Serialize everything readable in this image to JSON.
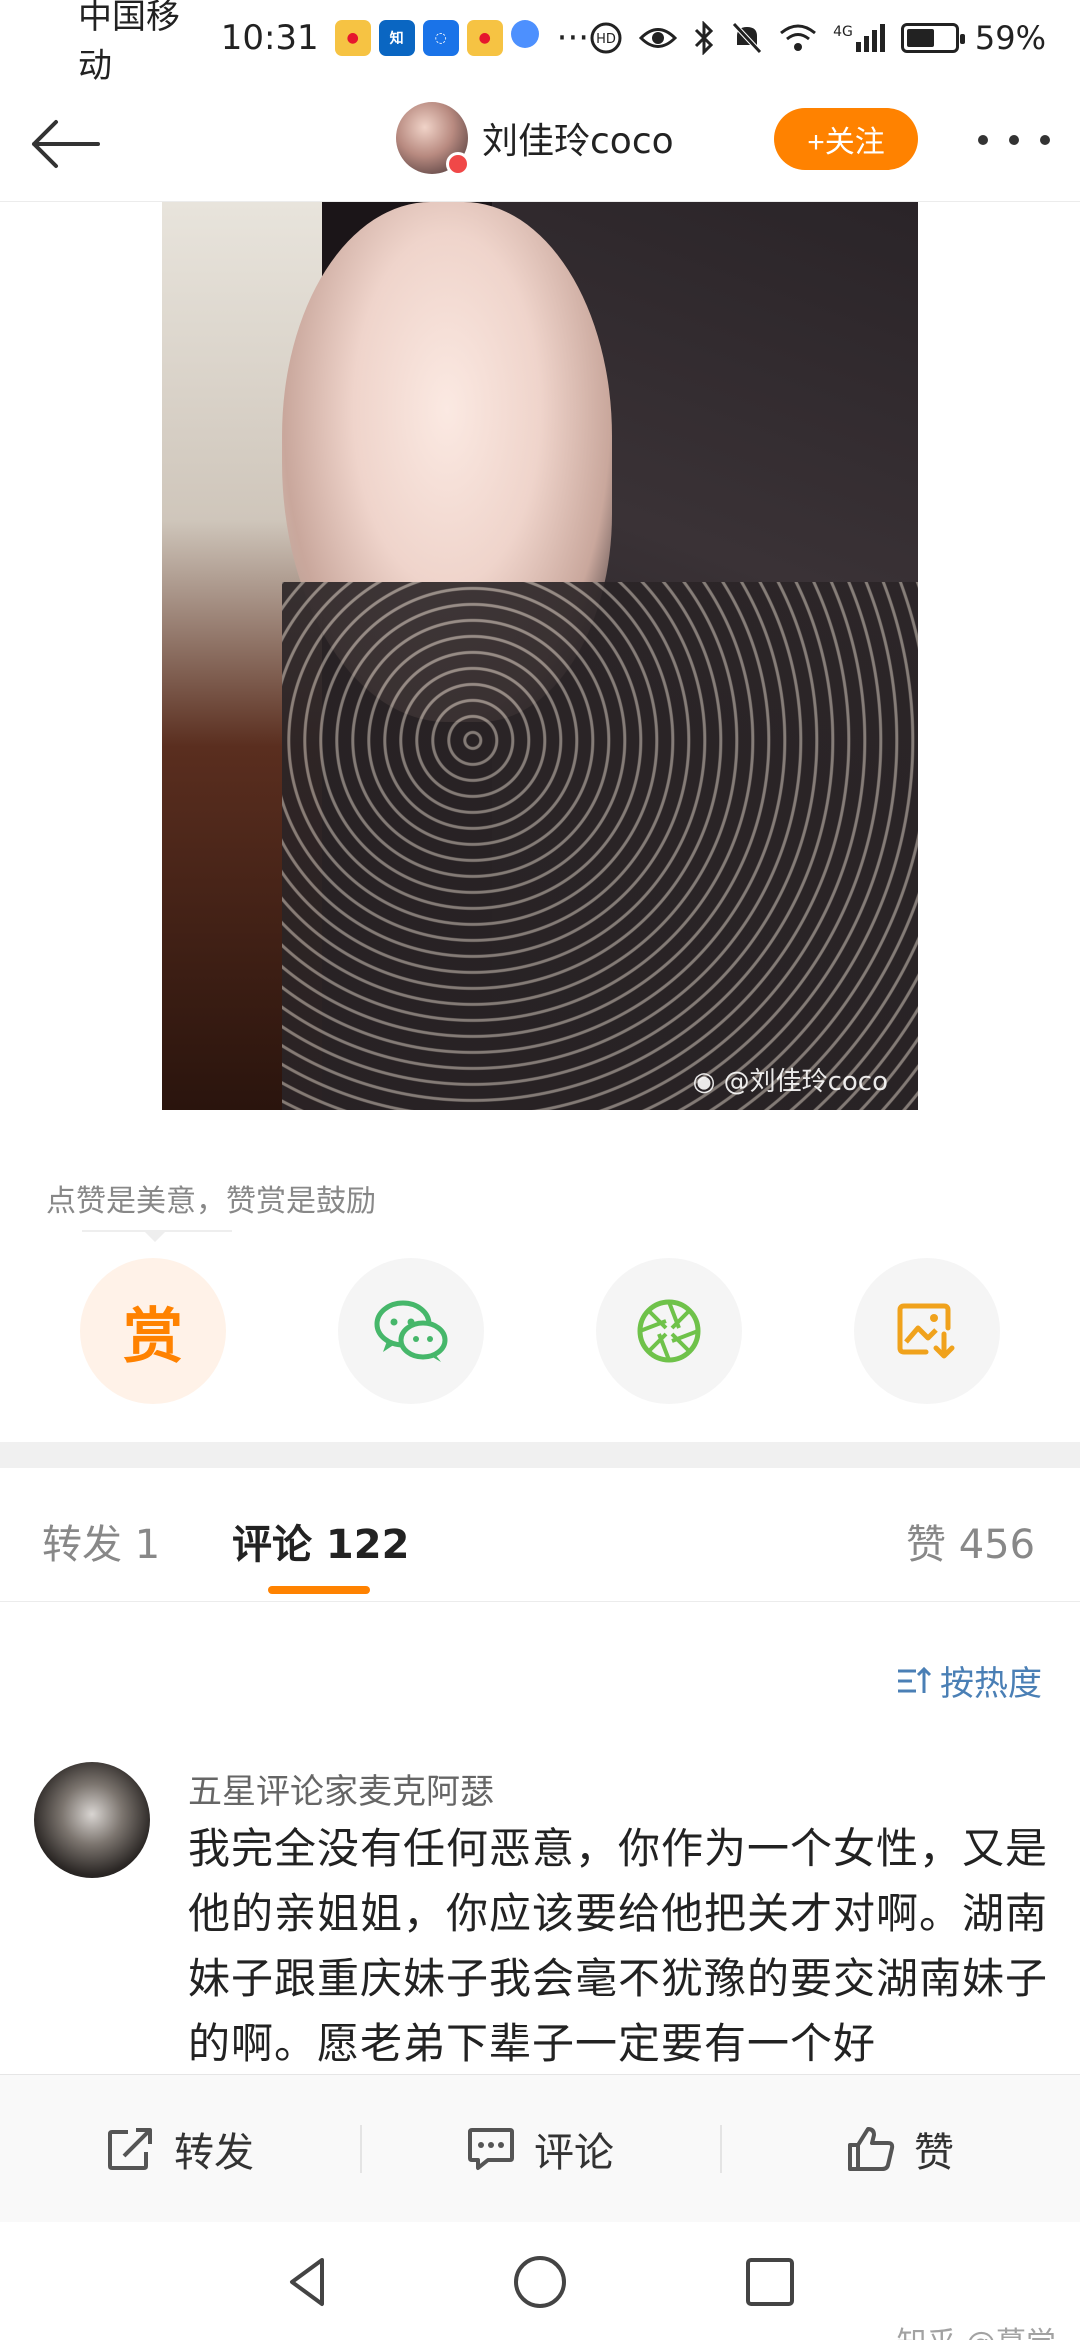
{
  "status_bar": {
    "carrier": "中国移动",
    "time": "10:31",
    "app_icons": [
      "weibo-icon",
      "zhihu-icon",
      "lightbulb-icon",
      "weibo-icon",
      "browser-icon"
    ],
    "more": "···",
    "network": "4G",
    "battery_percent": "59%",
    "battery_level": 0.59
  },
  "header": {
    "user_name": "刘佳玲coco",
    "follow_label": "+关注"
  },
  "photo": {
    "watermark": "@刘佳玲coco"
  },
  "reward": {
    "hint": "点赞是美意，赞赏是鼓励",
    "reward_glyph": "赏"
  },
  "tabs": {
    "repost": "转发 1",
    "comments": "评论 122",
    "likes": "赞 456"
  },
  "sort_label": "按热度",
  "comment": {
    "author": "五星评论家麦克阿瑟",
    "text": "我完全没有任何恶意，你作为一个女性，又是他的亲姐姐，你应该要给他把关才对啊。湖南妹子跟重庆妹子我会毫不犹豫的要交湖南妹子的啊。愿老弟下辈子一定要有一个好"
  },
  "actions": {
    "repost": "转发",
    "comment": "评论",
    "like": "赞"
  },
  "watermark": "知乎 @慕觉",
  "colors": {
    "accent": "#ff8200",
    "link": "#4a7fb5",
    "wechat": "#46b76a",
    "moments": "#6fc24a"
  }
}
